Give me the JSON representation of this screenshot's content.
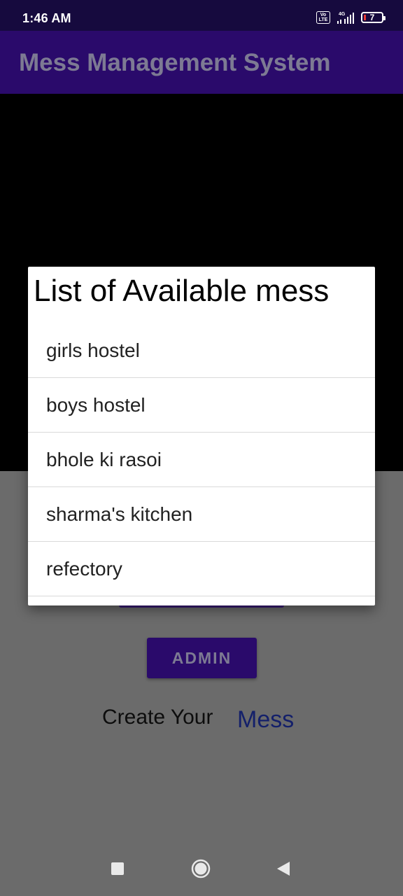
{
  "status_bar": {
    "time": "1:46 AM",
    "volte_label_top": "Vo",
    "volte_label_bottom": "LTE",
    "network_type": "4G",
    "battery_level": "7",
    "icons": [
      "volte-icon",
      "signal-icon",
      "battery-icon"
    ]
  },
  "app_bar": {
    "title": "Mess Management System"
  },
  "main": {
    "admin_button_label": "ADMIN",
    "create_prompt": "Create Your",
    "create_link": "Mess"
  },
  "dialog": {
    "title": "List of Available mess",
    "items": [
      {
        "label": "girls hostel"
      },
      {
        "label": "boys hostel"
      },
      {
        "label": "bhole ki rasoi"
      },
      {
        "label": "sharma's kitchen"
      },
      {
        "label": "refectory"
      }
    ]
  },
  "nav_bar": {
    "icons": [
      "recents-icon",
      "home-icon",
      "back-icon"
    ]
  },
  "colors": {
    "status_bar_bg": "#160a3e",
    "app_bar_bg": "#2a0a6b",
    "scrim_bg": "#6b6b6b",
    "dialog_bg": "#ffffff",
    "link_color": "#14206a",
    "battery_low": "#e53935"
  }
}
